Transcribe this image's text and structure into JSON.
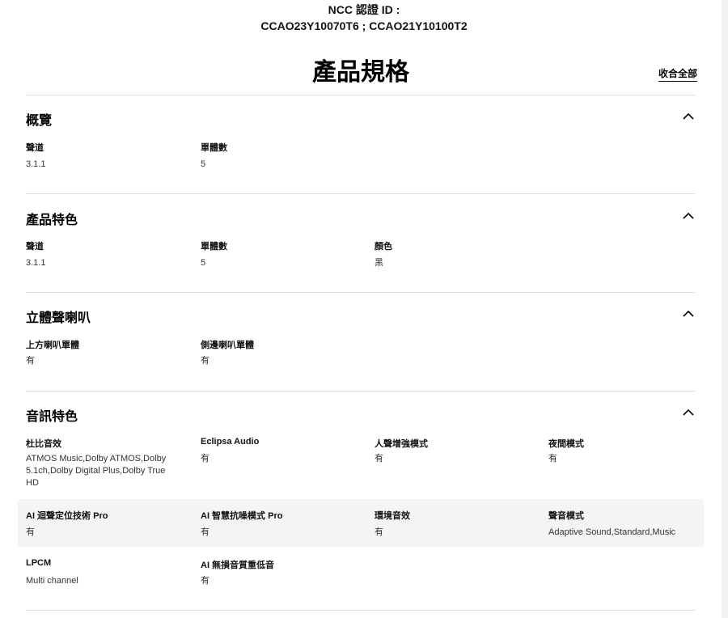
{
  "ncc": {
    "line1": "NCC 認證 ID :",
    "line2": "CCAO23Y10070T6 ; CCAO21Y10100T2"
  },
  "page_title": "產品規格",
  "collapse_all": "收合全部",
  "icons": {
    "section_toggle": "chevron-up-icon"
  },
  "sections": {
    "overview": {
      "title": "概覽",
      "items": [
        {
          "label": "聲道",
          "value": "3.1.1"
        },
        {
          "label": "單體數",
          "value": "5"
        }
      ]
    },
    "features": {
      "title": "產品特色",
      "items": [
        {
          "label": "聲道",
          "value": "3.1.1"
        },
        {
          "label": "單體數",
          "value": "5"
        },
        {
          "label": "顏色",
          "value": "黑"
        }
      ]
    },
    "speakers": {
      "title": "立體聲喇叭",
      "items": [
        {
          "label": "上方喇叭單體",
          "value": "有"
        },
        {
          "label": "側邊喇叭單體",
          "value": "有"
        }
      ]
    },
    "audio": {
      "title": "音訊特色",
      "items": [
        {
          "label": "杜比音效",
          "value": "ATMOS Music,Dolby ATMOS,Dolby 5.1ch,Dolby Digital Plus,Dolby True HD"
        },
        {
          "label": "Eclipsa Audio",
          "value": "有"
        },
        {
          "label": "人聲增強模式",
          "value": "有"
        },
        {
          "label": "夜間模式",
          "value": "有"
        },
        {
          "label": "AI 迴聲定位技術 Pro",
          "value": "有"
        },
        {
          "label": "AI 智慧抗噪模式 Pro",
          "value": "有"
        },
        {
          "label": "環境音效",
          "value": "有"
        },
        {
          "label": "聲音模式",
          "value": "Adaptive Sound,Standard,Music"
        },
        {
          "label": "LPCM",
          "value": "Multi channel"
        },
        {
          "label": "AI 無損音質重低音",
          "value": "有"
        }
      ]
    }
  }
}
